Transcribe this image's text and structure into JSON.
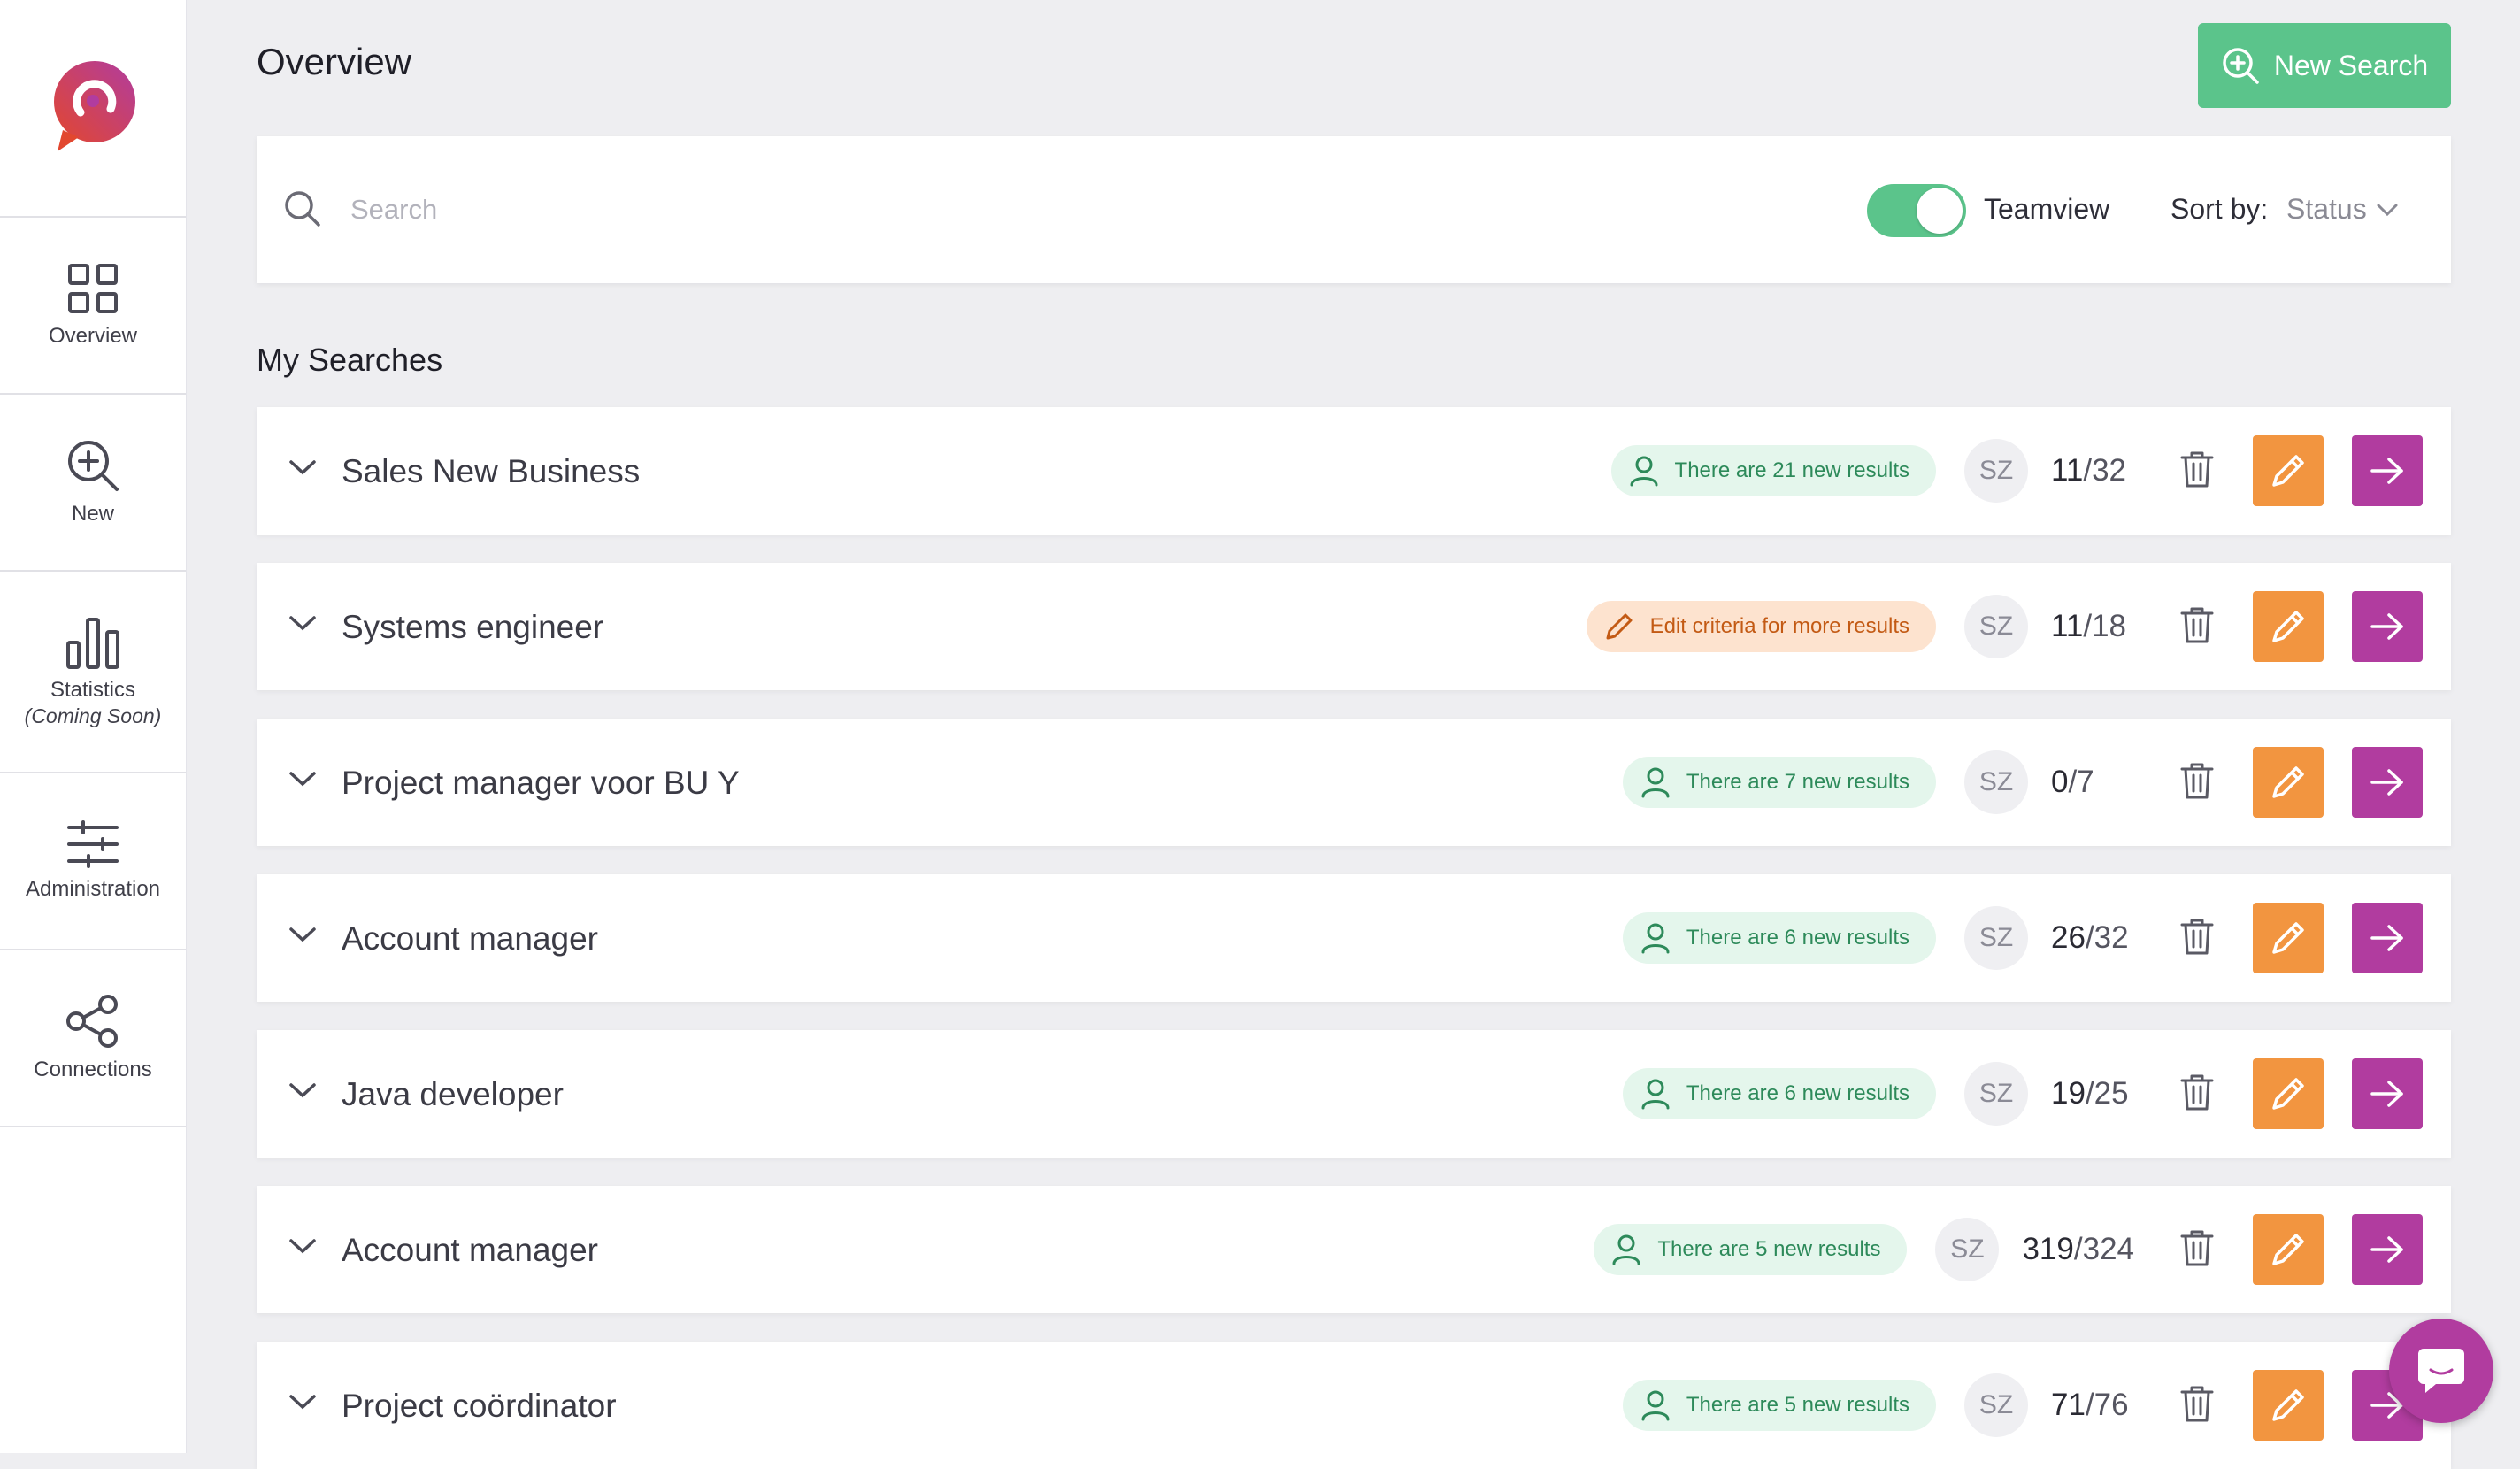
{
  "sidebar": {
    "items": [
      {
        "label": "Overview",
        "icon": "grid-icon"
      },
      {
        "label": "New",
        "icon": "search-plus-icon"
      },
      {
        "label": "Statistics",
        "sublabel": "(Coming Soon)",
        "icon": "bar-chart-icon"
      },
      {
        "label": "Administration",
        "icon": "sliders-icon"
      },
      {
        "label": "Connections",
        "icon": "share-icon"
      }
    ]
  },
  "header": {
    "title": "Overview",
    "new_search_label": "New Search"
  },
  "search": {
    "placeholder": "Search",
    "value": "",
    "teamview_label": "Teamview",
    "teamview_on": true,
    "sort_label": "Sort by:",
    "sort_value": "Status"
  },
  "section_title": "My Searches",
  "colors": {
    "accent_green": "#5bc48b",
    "edit_orange": "#f29540",
    "go_purple": "#b13c9f"
  },
  "searches": [
    {
      "title": "Sales New Business",
      "status": "There are 21 new results",
      "status_type": "green",
      "owner": "SZ",
      "count_a": "11",
      "count_b": "/32"
    },
    {
      "title": "Systems engineer",
      "status": "Edit criteria for more results",
      "status_type": "orange",
      "owner": "SZ",
      "count_a": "11",
      "count_b": "/18"
    },
    {
      "title": "Project manager voor BU Y",
      "status": "There are 7 new results",
      "status_type": "green",
      "owner": "SZ",
      "count_a": "0",
      "count_b": "/7"
    },
    {
      "title": "Account manager",
      "status": "There are 6 new results",
      "status_type": "green",
      "owner": "SZ",
      "count_a": "26",
      "count_b": "/32"
    },
    {
      "title": "Java developer",
      "status": "There are 6 new results",
      "status_type": "green",
      "owner": "SZ",
      "count_a": "19",
      "count_b": "/25"
    },
    {
      "title": "Account manager",
      "status": "There are 5 new results",
      "status_type": "green",
      "owner": "SZ",
      "count_a": "319",
      "count_b": "/324"
    },
    {
      "title": "Project coördinator",
      "status": "There are 5 new results",
      "status_type": "green",
      "owner": "SZ",
      "count_a": "71",
      "count_b": "/76"
    }
  ]
}
